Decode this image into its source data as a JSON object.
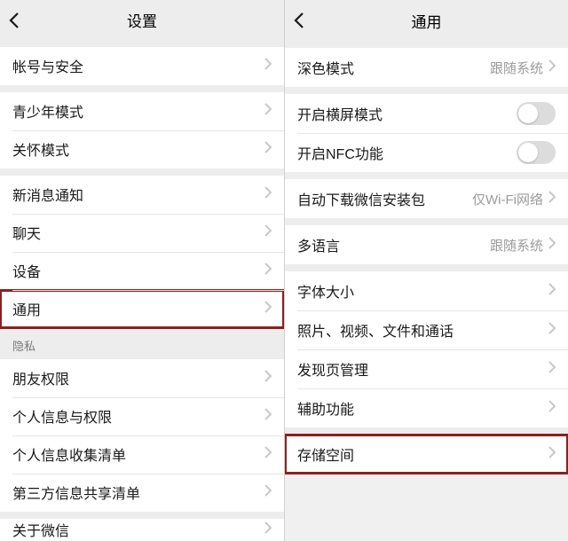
{
  "left": {
    "title": "设置",
    "groups": [
      {
        "items": [
          {
            "label": "帐号与安全"
          }
        ]
      },
      {
        "items": [
          {
            "label": "青少年模式"
          },
          {
            "label": "关怀模式"
          }
        ]
      },
      {
        "items": [
          {
            "label": "新消息通知"
          },
          {
            "label": "聊天"
          },
          {
            "label": "设备"
          },
          {
            "label": "通用",
            "highlight": true
          }
        ]
      },
      {
        "section": "隐私",
        "items": [
          {
            "label": "朋友权限"
          },
          {
            "label": "个人信息与权限"
          },
          {
            "label": "个人信息收集清单"
          },
          {
            "label": "第三方信息共享清单"
          }
        ]
      },
      {
        "items": [
          {
            "label": "关于微信"
          }
        ],
        "partial": true
      }
    ]
  },
  "right": {
    "title": "通用",
    "groups": [
      {
        "items": [
          {
            "label": "深色模式",
            "value": "跟随系统"
          }
        ]
      },
      {
        "items": [
          {
            "label": "开启横屏模式",
            "toggle": true
          },
          {
            "label": "开启NFC功能",
            "toggle": true
          }
        ]
      },
      {
        "items": [
          {
            "label": "自动下载微信安装包",
            "value": "仅Wi-Fi网络"
          }
        ]
      },
      {
        "items": [
          {
            "label": "多语言",
            "value": "跟随系统"
          }
        ]
      },
      {
        "items": [
          {
            "label": "字体大小"
          },
          {
            "label": "照片、视频、文件和通话"
          },
          {
            "label": "发现页管理"
          },
          {
            "label": "辅助功能"
          }
        ]
      },
      {
        "items": [
          {
            "label": "存储空间",
            "highlight": true
          }
        ]
      }
    ]
  }
}
